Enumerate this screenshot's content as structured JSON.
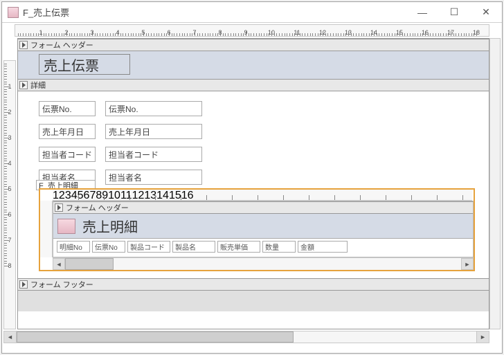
{
  "window": {
    "title": "F_売上伝票",
    "buttons": {
      "min": "—",
      "max": "☐",
      "close": "✕"
    }
  },
  "ruler_labels": [
    "1",
    "2",
    "3",
    "4",
    "5",
    "6",
    "7",
    "8",
    "9",
    "10",
    "11",
    "12",
    "13",
    "14",
    "15",
    "16",
    "17",
    "18"
  ],
  "vruler_labels": [
    "1",
    "2",
    "3",
    "4",
    "5",
    "6",
    "7",
    "8"
  ],
  "sections": {
    "form_header": "フォーム ヘッダー",
    "detail": "詳細",
    "form_footer": "フォーム フッター"
  },
  "header": {
    "title_label": "売上伝票"
  },
  "fields": [
    {
      "label": "伝票No.",
      "control": "伝票No."
    },
    {
      "label": "売上年月日",
      "control": "売上年月日"
    },
    {
      "label": "担当者コード",
      "control": "担当者コード"
    },
    {
      "label": "担当者名",
      "control": "担当者名"
    }
  ],
  "subform": {
    "label": "F_売上明細",
    "ruler_labels": [
      "1",
      "2",
      "3",
      "4",
      "5",
      "6",
      "7",
      "8",
      "9",
      "10",
      "11",
      "12",
      "13",
      "14",
      "15",
      "16"
    ],
    "sections": {
      "form_header": "フォーム ヘッダー"
    },
    "title": "売上明細",
    "columns": [
      {
        "label": "明細No",
        "w": 48
      },
      {
        "label": "伝票No",
        "w": 48
      },
      {
        "label": "製品コード",
        "w": 62
      },
      {
        "label": "製品名",
        "w": 62
      },
      {
        "label": "販売単価",
        "w": 62
      },
      {
        "label": "数量",
        "w": 48
      },
      {
        "label": "金額",
        "w": 72
      }
    ]
  }
}
